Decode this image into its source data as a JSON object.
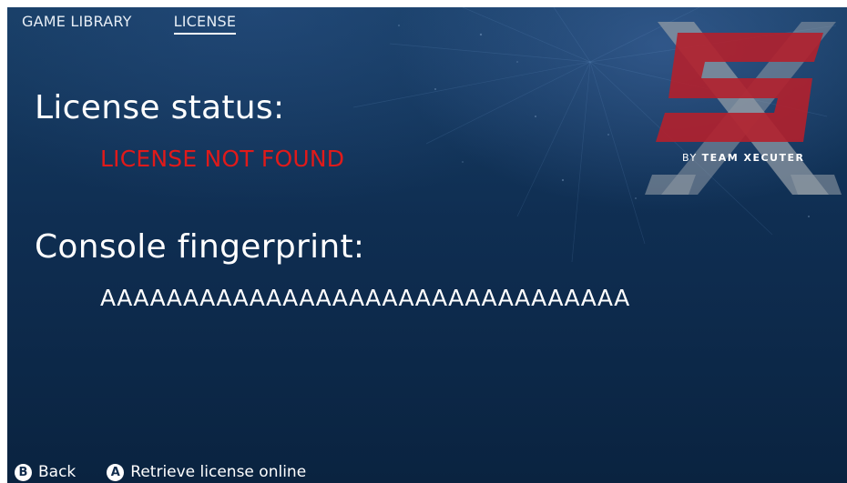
{
  "tabs": [
    {
      "label": "GAME LIBRARY",
      "active": false
    },
    {
      "label": "LICENSE",
      "active": true
    }
  ],
  "license": {
    "heading": "License status:",
    "status": "LICENSE NOT FOUND",
    "status_color": "#e01a1a"
  },
  "fingerprint": {
    "heading": "Console fingerprint:",
    "value": "AAAAAAAAAAAAAAAAAAAAAAAAAAAAAAAA"
  },
  "logo": {
    "icon": "sx-logo-icon",
    "by_text": "BY",
    "brand_text": "TEAM XECUTER",
    "primary_color": "#b3202c",
    "secondary_color": "#9aa4ae"
  },
  "footer": {
    "back": {
      "button": "B",
      "label": "Back"
    },
    "retrieve": {
      "button": "A",
      "label": "Retrieve license online"
    }
  }
}
